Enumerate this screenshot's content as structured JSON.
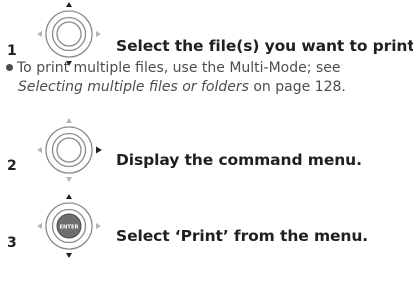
{
  "steps": [
    {
      "number": "1",
      "title": "Select the file(s) you want to print.",
      "dial_icon": "cursor-dial-up-down-icon"
    },
    {
      "number": "2",
      "title": "Display the command menu.",
      "dial_icon": "cursor-dial-right-icon"
    },
    {
      "number": "3",
      "title": "Select ‘Print’ from the menu.",
      "dial_icon": "enter-dial-icon",
      "enter_label": "ENTER"
    }
  ],
  "note": {
    "line1": "To print multiple files, use the Multi-Mode; see",
    "link_text": "Selecting multiple files or folders",
    "line2_suffix": " on page 128."
  },
  "colors": {
    "text": "#231f20",
    "note_text": "#4d4d4d",
    "dial_stroke": "#8a8a8a",
    "active_arrow": "#231f20",
    "inactive_arrow": "#b5b5b5"
  }
}
